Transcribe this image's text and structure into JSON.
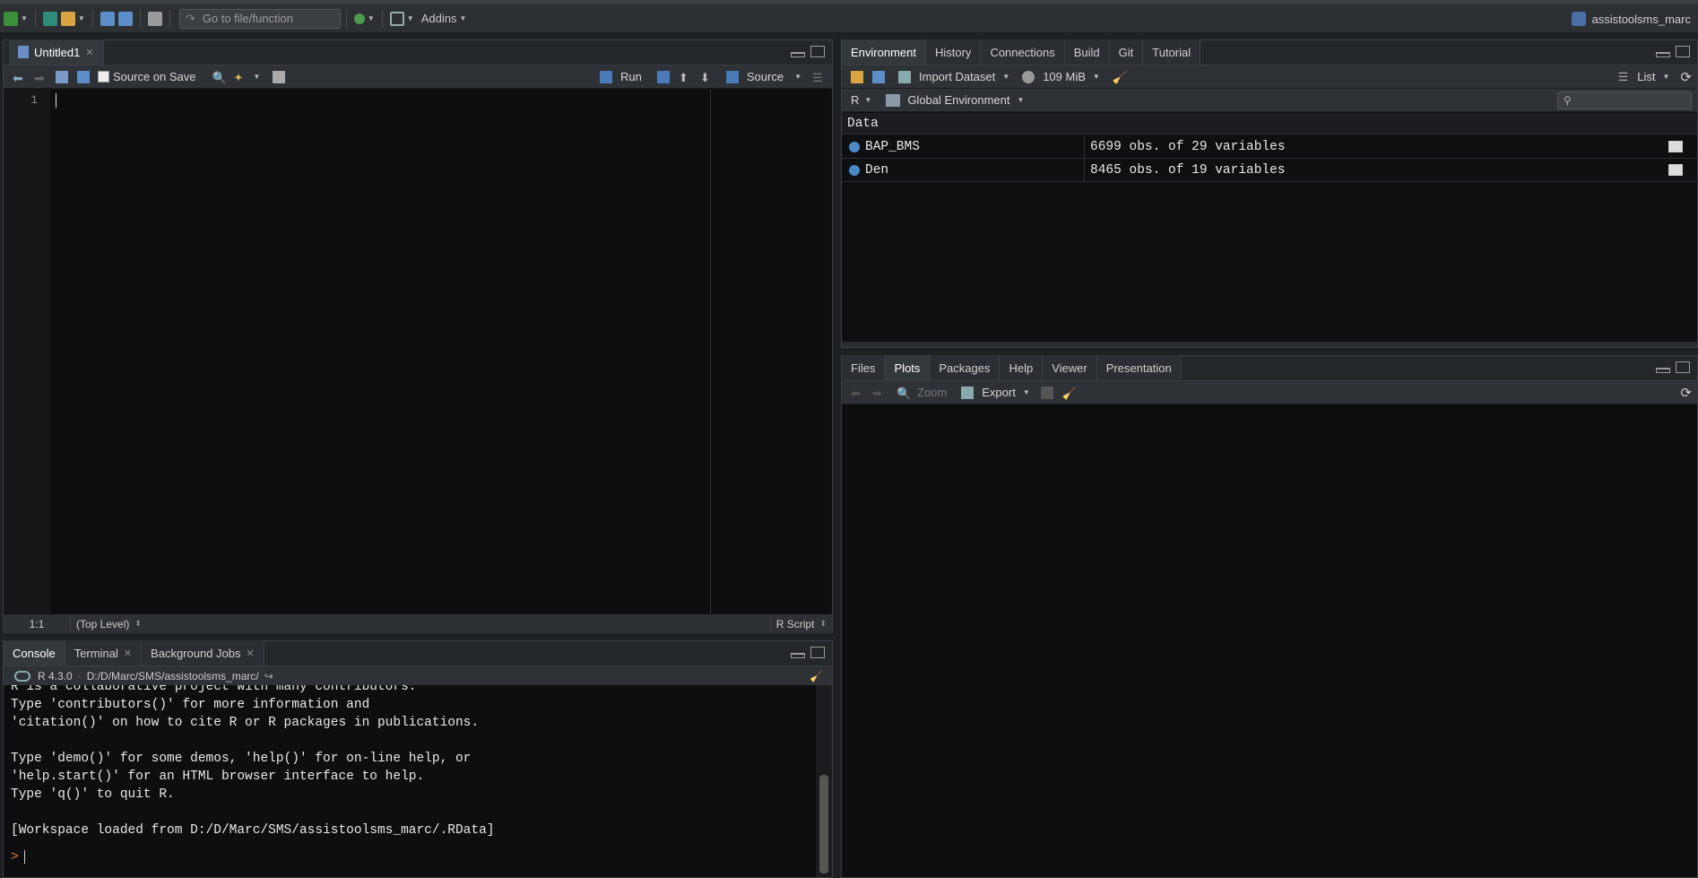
{
  "main_toolbar": {
    "goto_placeholder": "Go to file/function",
    "addins_label": "Addins",
    "project_name": "assistoolsms_marc"
  },
  "editor": {
    "tab_label": "Untitled1",
    "source_on_save": "Source on Save",
    "run_label": "Run",
    "source_label": "Source",
    "line_number": "1",
    "cursor_pos": "1:1",
    "scope": "(Top Level)",
    "file_type": "R Script"
  },
  "console": {
    "tabs": [
      "Console",
      "Terminal",
      "Background Jobs"
    ],
    "r_version": "R 4.3.0",
    "path": "D:/D/Marc/SMS/assistoolsms_marc/",
    "lines": [
      "R is a collaborative project with many contributors.",
      "Type 'contributors()' for more information and",
      "'citation()' on how to cite R or R packages in publications.",
      "",
      "Type 'demo()' for some demos, 'help()' for on-line help, or",
      "'help.start()' for an HTML browser interface to help.",
      "Type 'q()' to quit R.",
      "",
      "[Workspace loaded from D:/D/Marc/SMS/assistoolsms_marc/.RData]"
    ],
    "prompt": ">"
  },
  "environment": {
    "tabs": [
      "Environment",
      "History",
      "Connections",
      "Build",
      "Git",
      "Tutorial"
    ],
    "import_label": "Import Dataset",
    "memory": "109 MiB",
    "list_label": "List",
    "lang": "R",
    "scope": "Global Environment",
    "section": "Data",
    "rows": [
      {
        "name": "BAP_BMS",
        "value": "6699 obs. of 29 variables"
      },
      {
        "name": "Den",
        "value": "8465 obs. of 19 variables"
      }
    ]
  },
  "files": {
    "tabs": [
      "Files",
      "Plots",
      "Packages",
      "Help",
      "Viewer",
      "Presentation"
    ],
    "zoom_label": "Zoom",
    "export_label": "Export"
  }
}
